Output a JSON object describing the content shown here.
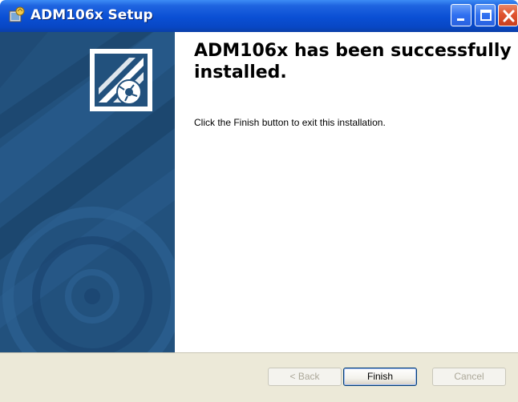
{
  "window": {
    "title": "ADM106x Setup",
    "icon": "installer-icon"
  },
  "titlebar_buttons": [
    "minimize",
    "maximize",
    "close"
  ],
  "content": {
    "heading": "ADM106x has been successfully installed.",
    "message": "Click the Finish button to exit this installation."
  },
  "buttons": {
    "back": "< Back",
    "finish": "Finish",
    "cancel": "Cancel"
  },
  "colors": {
    "titlebar": "#0a4fd4",
    "banner": "#22517d",
    "footer": "#ece9d8"
  }
}
